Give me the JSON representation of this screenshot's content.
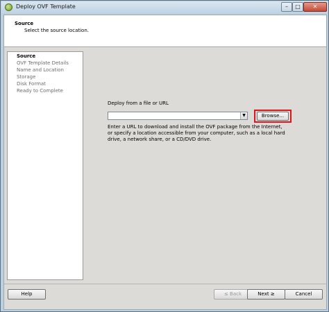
{
  "window": {
    "title": "Deploy OVF Template",
    "minimize_glyph": "–",
    "maximize_glyph": "□",
    "close_glyph": "✕"
  },
  "header": {
    "title": "Source",
    "subtitle": "Select the source location."
  },
  "steps": [
    {
      "label": "Source",
      "active": true
    },
    {
      "label": "OVF Template Details",
      "active": false
    },
    {
      "label": "Name and Location",
      "active": false
    },
    {
      "label": "Storage",
      "active": false
    },
    {
      "label": "Disk Format",
      "active": false
    },
    {
      "label": "Ready to Complete",
      "active": false
    }
  ],
  "source": {
    "deploy_label": "Deploy from a file or URL",
    "url_value": "",
    "dropdown_glyph": "▼",
    "browse_label": "Browse...",
    "browse_highlight_color": "#e0121a",
    "help_text": "Enter a URL to download and install the OVF package from the Internet, or specify a location accessible from your computer, such as a local hard drive, a network share, or a CD/DVD drive."
  },
  "footer": {
    "help_label": "Help",
    "back_label": "≤ Back",
    "next_label": "Next ≥",
    "cancel_label": "Cancel"
  }
}
